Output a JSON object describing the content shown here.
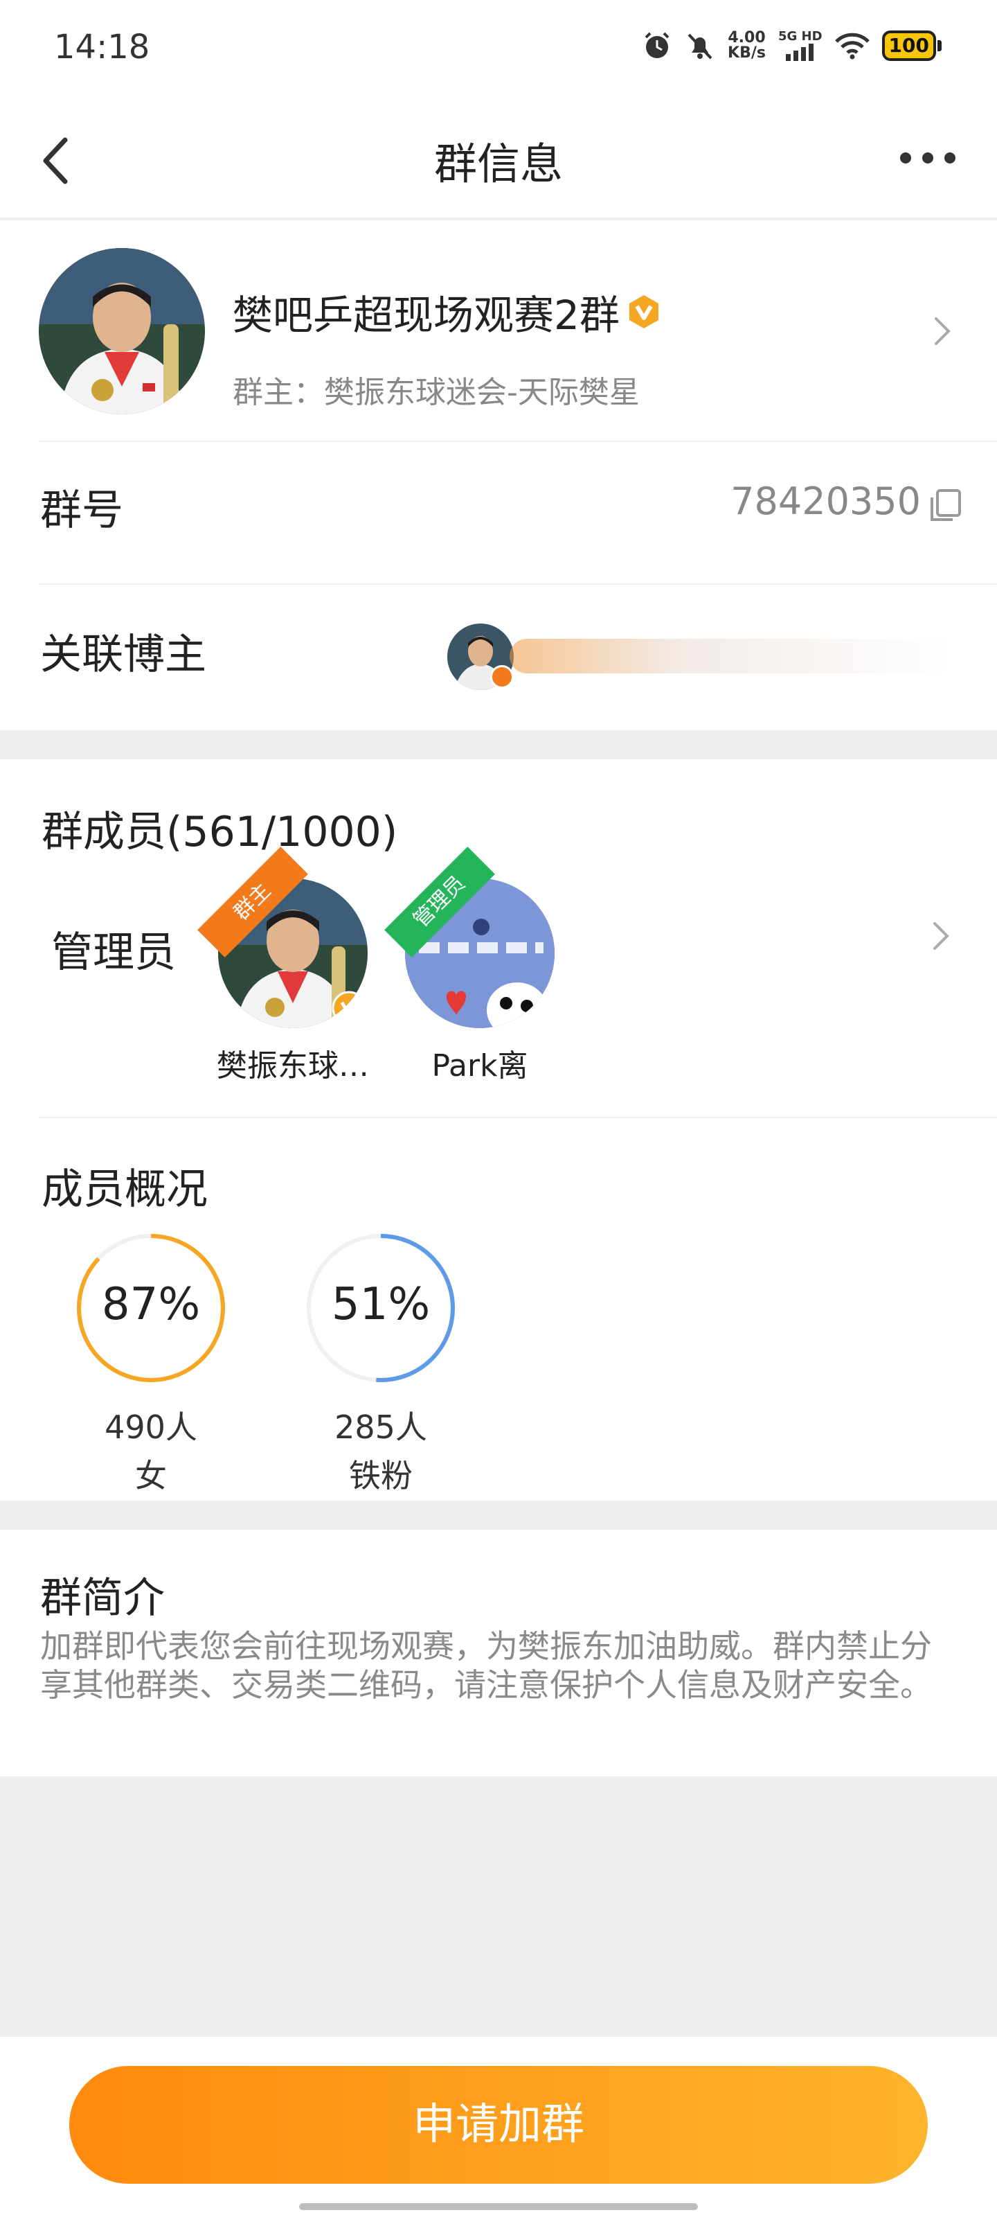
{
  "status_bar": {
    "time": "14:18",
    "net_speed_value": "4.00",
    "net_speed_unit": "KB/s",
    "network": "5G HD",
    "battery": "100"
  },
  "header": {
    "title": "群信息"
  },
  "group": {
    "name": "樊吧乒超现场观赛2群",
    "owner_text": "群主：樊振东球迷会-天际樊星",
    "number_label": "群号",
    "number_value": "78420350",
    "linked_blogger_label": "关联博主"
  },
  "members": {
    "title": "群成员(561/1000)",
    "admin_label": "管理员",
    "admins": [
      {
        "name": "樊振东球…",
        "role": "群主"
      },
      {
        "name": "Park离",
        "role": "管理员"
      }
    ]
  },
  "overview": {
    "title": "成员概况",
    "stats": [
      {
        "percent_text": "87%",
        "percent": 87,
        "count": "490人",
        "label": "女",
        "color": "#f5a623"
      },
      {
        "percent_text": "51%",
        "percent": 51,
        "count": "285人",
        "label": "铁粉",
        "color": "#5b9be8"
      }
    ]
  },
  "intro": {
    "title": "群简介",
    "text": "加群即代表您会前往现场观赛，为樊振东加油助威。群内禁止分享其他群类、交易类二维码，请注意保护个人信息及财产安全。"
  },
  "footer": {
    "join_label": "申请加群"
  },
  "colors": {
    "accent": "#ff8a0d",
    "accent_end": "#fdb42c",
    "badge": "#f5a623"
  },
  "icons": [
    "back-arrow-icon",
    "more-icon",
    "verified-badge-icon",
    "chevron-right-icon",
    "copy-icon",
    "alarm-icon",
    "mute-icon",
    "signal-icon",
    "wifi-icon",
    "battery-icon"
  ]
}
